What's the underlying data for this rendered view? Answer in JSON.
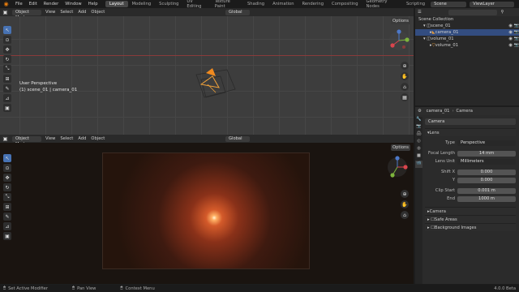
{
  "topbar": {
    "menus": [
      "File",
      "Edit",
      "Render",
      "Window",
      "Help"
    ],
    "workspaces": [
      "Layout",
      "Modeling",
      "Sculpting",
      "UV Editing",
      "Texture Paint",
      "Shading",
      "Animation",
      "Rendering",
      "Compositing",
      "Geometry Nodes",
      "Scripting"
    ],
    "active_workspace": "Layout",
    "scene": "Scene",
    "view_layer": "ViewLayer"
  },
  "viewport": {
    "mode": "Object Mode",
    "menus": [
      "View",
      "Select",
      "Add",
      "Object"
    ],
    "orientation": "Global",
    "options": "Options",
    "overlay_title": "User Perspective",
    "overlay_sub": "(1) scene_01 | camera_01",
    "axis_labels": [
      "Z",
      "Y",
      "X"
    ]
  },
  "render_view": {
    "mode": "Object Mode",
    "menus": [
      "View",
      "Select",
      "Add",
      "Object"
    ],
    "orientation": "Global",
    "options": "Options"
  },
  "outliner": {
    "title": "Scene Collection",
    "items": [
      {
        "label": "scene_01",
        "indent": 1
      },
      {
        "label": "camera_01",
        "indent": 2,
        "selected": true
      },
      {
        "label": "volume_01",
        "indent": 1
      },
      {
        "label": "volume_01",
        "indent": 2
      }
    ]
  },
  "properties": {
    "breadcrumb_object": "camera_01",
    "breadcrumb_data": "Camera",
    "data_name": "Camera",
    "lens_section": "Lens",
    "type_label": "Type",
    "type_value": "Perspective",
    "focal_label": "Focal Length",
    "focal_value": "14 mm",
    "unit_label": "Lens Unit",
    "unit_value": "Millimeters",
    "shiftx_label": "Shift X",
    "shiftx_value": "0.000",
    "shifty_label": "Y",
    "shifty_value": "0.000",
    "clipstart_label": "Clip Start",
    "clipstart_value": "0.001 m",
    "clipend_label": "End",
    "clipend_value": "1000 m",
    "sections": [
      "Camera",
      "Safe Areas",
      "Background Images"
    ]
  },
  "statusbar": {
    "left": "Set Active Modifier",
    "middle": "Pan View",
    "right": "Context Menu",
    "version": "4.0.0 Beta"
  }
}
